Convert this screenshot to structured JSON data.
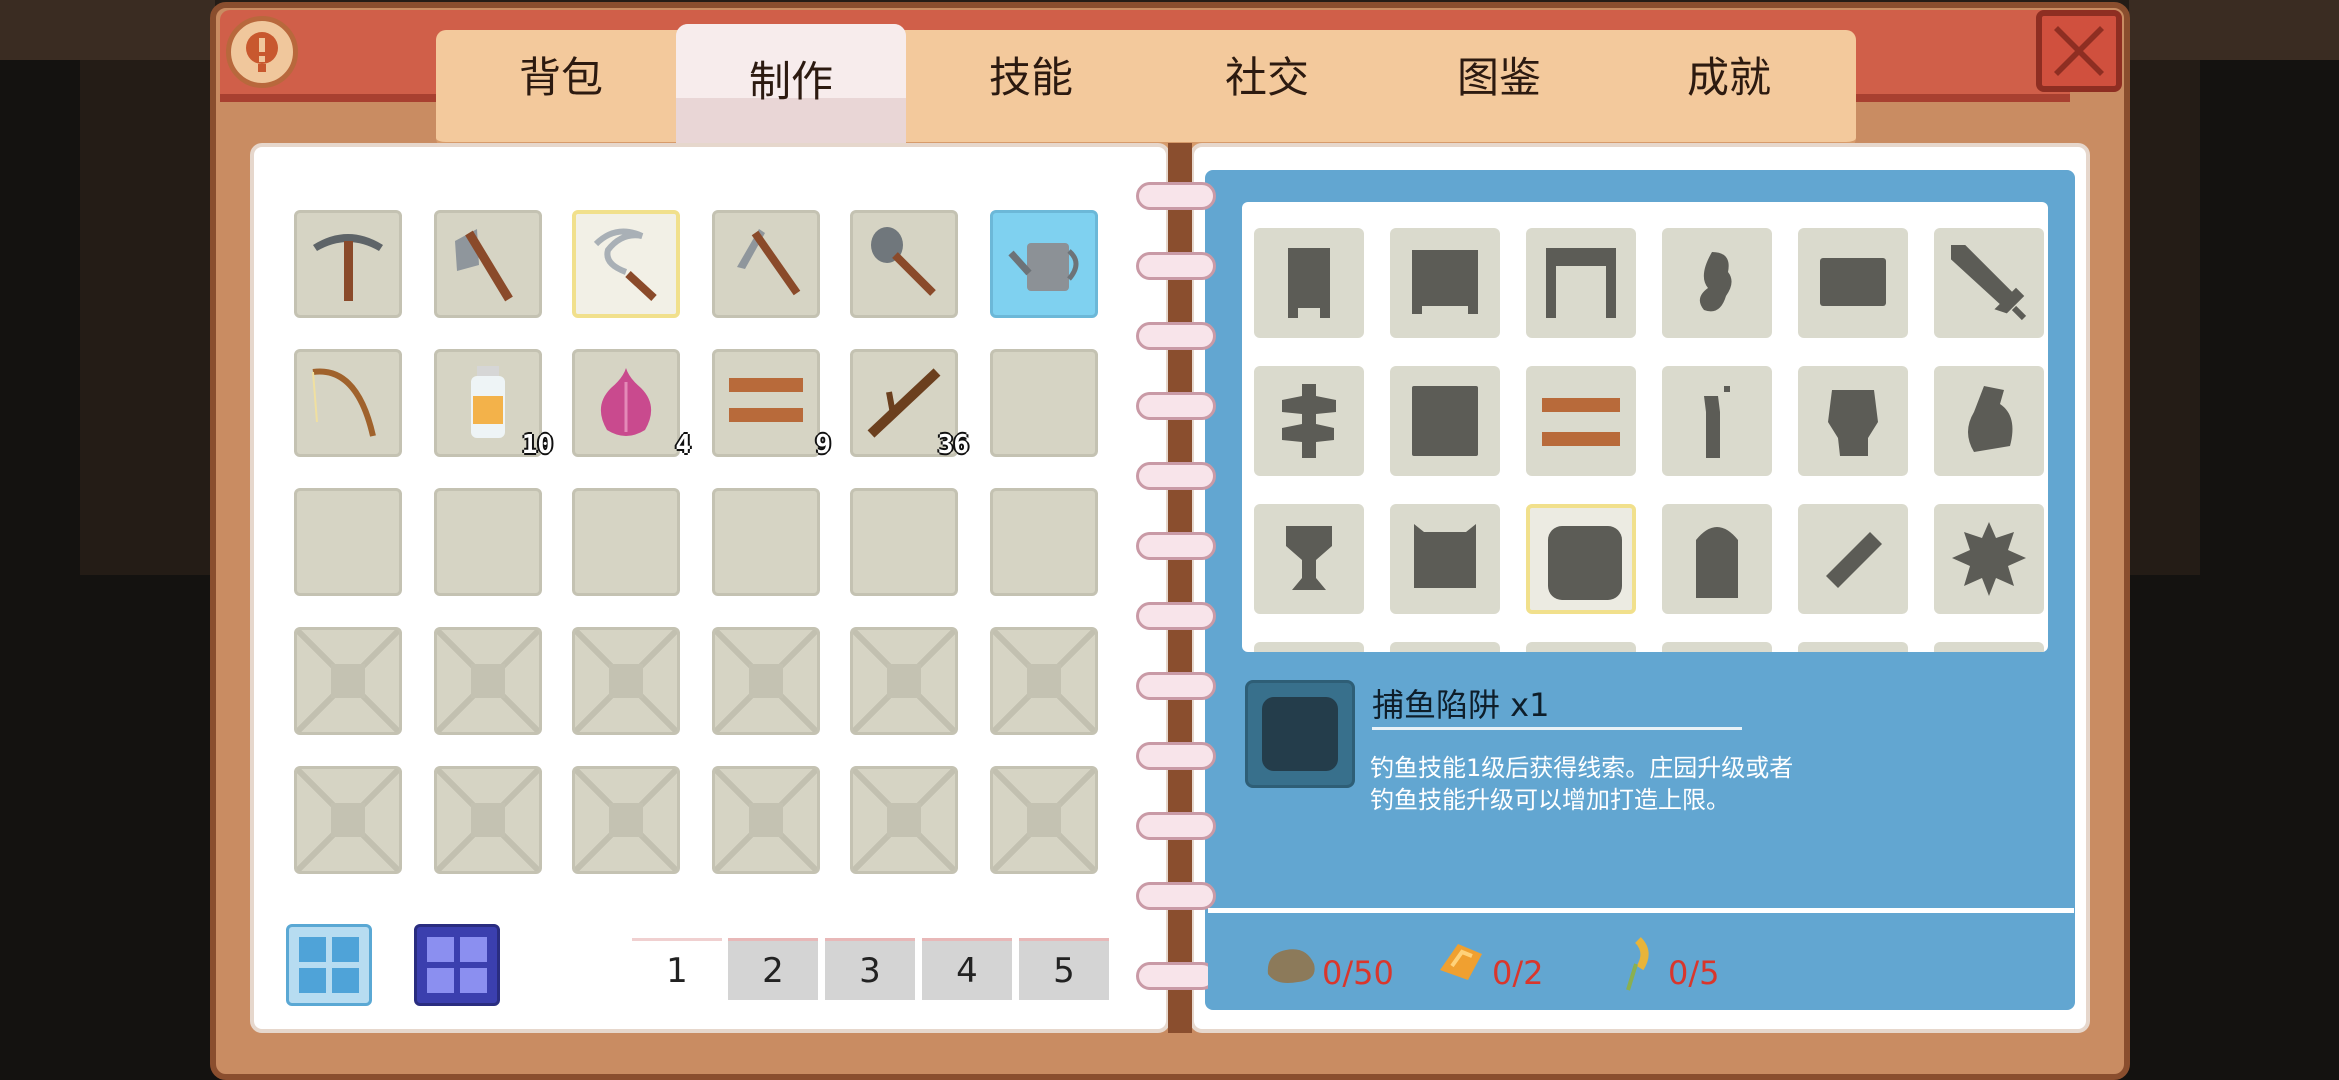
{
  "tabs": [
    {
      "label": "背包",
      "active": false
    },
    {
      "label": "制作",
      "active": true
    },
    {
      "label": "技能",
      "active": false
    },
    {
      "label": "社交",
      "active": false
    },
    {
      "label": "图鉴",
      "active": false
    },
    {
      "label": "成就",
      "active": false
    }
  ],
  "inventory": {
    "items": [
      {
        "icon": "pickaxe-icon"
      },
      {
        "icon": "axe-icon"
      },
      {
        "icon": "sickle-icon",
        "selected": true
      },
      {
        "icon": "hoe-icon"
      },
      {
        "icon": "shovel-icon"
      },
      {
        "icon": "watering-can-icon"
      },
      {
        "icon": "fishing-rod-icon"
      },
      {
        "icon": "jar-icon",
        "count": "10"
      },
      {
        "icon": "onion-icon",
        "count": "4"
      },
      {
        "icon": "wood-plank-icon",
        "count": "9"
      },
      {
        "icon": "branch-icon",
        "count": "36"
      }
    ],
    "pages": [
      "1",
      "2",
      "3",
      "4",
      "5"
    ],
    "active_page": "1"
  },
  "recipes": [
    "door-silhouette-icon",
    "cabinet-silhouette-icon",
    "table-silhouette-icon",
    "hand-silhouette-icon",
    "block-silhouette-icon",
    "sword-silhouette-icon",
    "signpost-silhouette-icon",
    "box-silhouette-icon",
    "wood-plank-icon",
    "bottle-silhouette-icon",
    "head-silhouette-icon",
    "bag-silhouette-icon",
    "trophy-silhouette-icon",
    "barrel-silhouette-icon",
    "fish-trap-silhouette-icon",
    "tombstone-silhouette-icon",
    "capsule-silhouette-icon",
    "bush-silhouette-icon"
  ],
  "selected_recipe": {
    "title": "捕鱼陷阱 x1",
    "description": "钓鱼技能1级后获得线索。庄园升级或者钓鱼技能升级可以增加打造上限。"
  },
  "materials": [
    {
      "icon": "stone-icon",
      "qty": "0/50"
    },
    {
      "icon": "copper-ore-icon",
      "qty": "0/2"
    },
    {
      "icon": "fiber-icon",
      "qty": "0/5"
    }
  ],
  "colors": {
    "frame": "#c98c62",
    "topbar": "#d05f49",
    "panel_blue": "#62a6d1",
    "shortage_red": "#d9362c"
  }
}
